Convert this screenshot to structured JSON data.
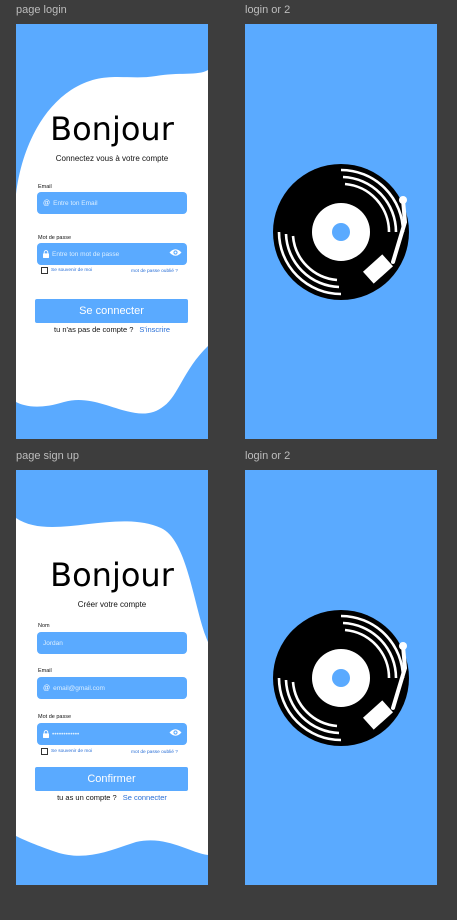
{
  "frames": {
    "login_label": "page login",
    "login_or_2_a_label": "login or 2",
    "signup_label": "page sign up",
    "login_or_2_b_label": "login or 2"
  },
  "login": {
    "title": "Bonjour",
    "subtitle": "Connectez vous à votre compte",
    "email_label": "Email",
    "email_placeholder": "Entre ton Email",
    "password_label": "Mot de passe",
    "password_placeholder": "Entre ton mot de passe",
    "remember": "Se souvenir de moi",
    "forgot": "mot de passe oublié ?",
    "submit": "Se connecter",
    "no_account": "tu n'as pas de compte ?",
    "signup_link": "S'inscrire"
  },
  "signup": {
    "title": "Bonjour",
    "subtitle": "Créer votre compte",
    "name_label": "Nom",
    "name_placeholder": "Jordan",
    "email_label": "Email",
    "email_placeholder": "email@gmail.com",
    "password_label": "Mot de passe",
    "password_value": "••••••••••••",
    "remember": "Se souvenir de moi",
    "forgot": "mot de passe oublié ?",
    "submit": "Confirmer",
    "has_account": "tu as un compte ?",
    "login_link": "Se connecter"
  },
  "colors": {
    "canvas": "#3d3d3d",
    "brand_blue": "#5aaaff",
    "link_blue": "#2a6fd6",
    "surface": "#ffffff"
  },
  "icons": [
    "at-icon",
    "lock-icon",
    "eye-icon",
    "vinyl-record-icon"
  ]
}
